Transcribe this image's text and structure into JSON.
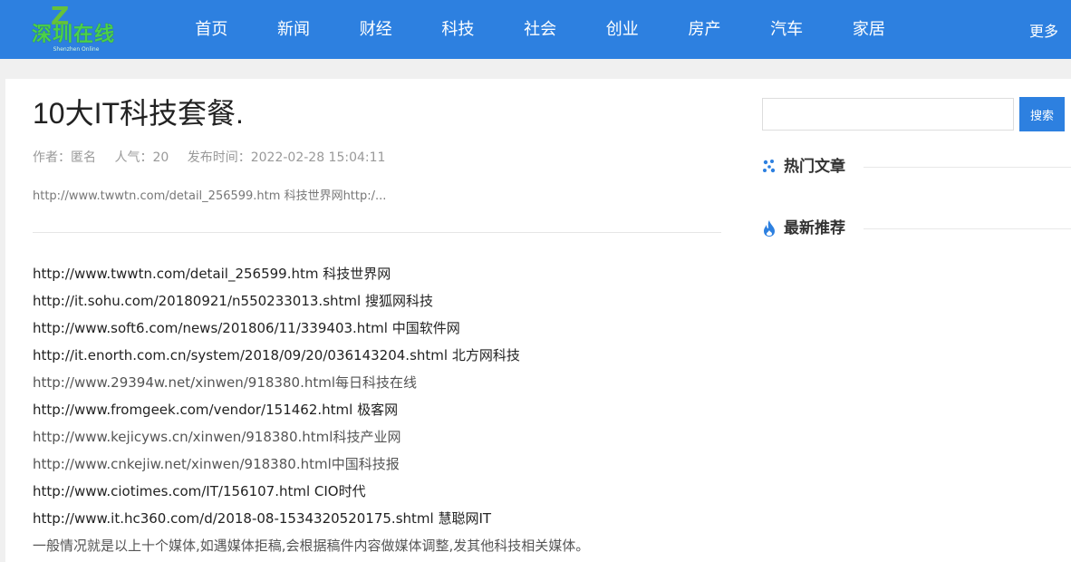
{
  "header": {
    "logo": {
      "mark": "Z",
      "name": "深圳在线",
      "sub": "Shenzhen Online"
    },
    "nav": [
      "首页",
      "新闻",
      "财经",
      "科技",
      "社会",
      "创业",
      "房产",
      "汽车",
      "家居"
    ],
    "more": "更多"
  },
  "article": {
    "title": "10大IT科技套餐.",
    "meta": {
      "author": "作者：匿名",
      "views": "人气：20",
      "published": "发布时间：2022-02-28 15:04:11"
    },
    "summary": "http://www.twwtn.com/detail_256599.htm 科技世界网http:/...",
    "lines": [
      "http://www.twwtn.com/detail_256599.htm 科技世界网",
      "http://it.sohu.com/20180921/n550233013.shtml 搜狐网科技",
      "http://www.soft6.com/news/201806/11/339403.html 中国软件网",
      "http://it.enorth.com.cn/system/2018/09/20/036143204.shtml 北方网科技",
      "http://www.29394w.net/xinwen/918380.html每日科技在线",
      "http://www.fromgeek.com/vendor/151462.html 极客网",
      "http://www.kejicyws.cn/xinwen/918380.html科技产业网",
      "http://www.cnkejiw.net/xinwen/918380.html中国科技报",
      "http://www.ciotimes.com/IT/156107.html  CIO时代",
      "http://www.it.hc360.com/d/2018-08-1534320520175.shtml 慧聪网IT",
      "一般情况就是以上十个媒体,如遇媒体拒稿,会根据稿件内容做媒体调整,发其他科技相关媒体。"
    ]
  },
  "sidebar": {
    "search": {
      "value": "",
      "placeholder": "",
      "button": "搜索"
    },
    "hot": {
      "label": "热门文章",
      "icon": "sparkle-icon"
    },
    "latest": {
      "label": "最新推荐",
      "icon": "flame-icon"
    }
  },
  "colors": {
    "brand": "#2d80e0",
    "logo_green": "#4bd04b"
  }
}
